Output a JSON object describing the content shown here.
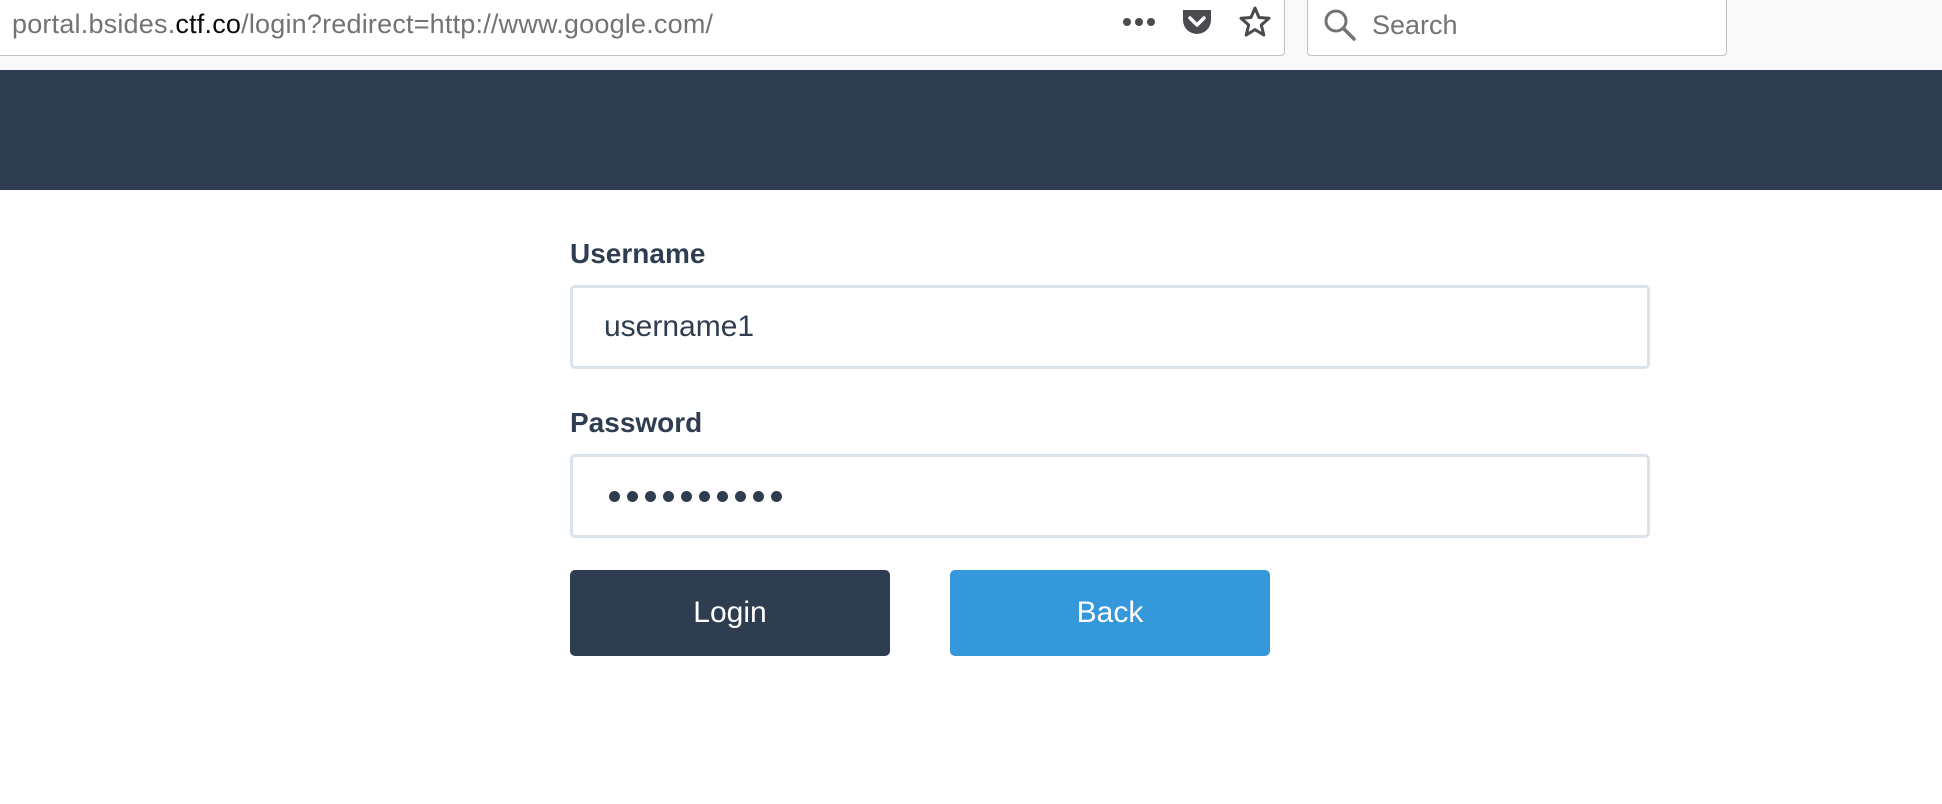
{
  "browser": {
    "url_prefix": "portal.bsides.",
    "url_host": "ctf.co",
    "url_path": "/login?redirect=http://www.google.com/",
    "actions": [
      {
        "icon": "more-icon"
      },
      {
        "icon": "pocket-icon"
      },
      {
        "icon": "star-icon"
      }
    ],
    "search_placeholder": "Search"
  },
  "form": {
    "username_label": "Username",
    "username_value": "username1",
    "password_label": "Password",
    "password_mask_length": 10,
    "login_label": "Login",
    "back_label": "Back"
  },
  "colors": {
    "header": "#2e3e50",
    "primary_button": "#2e3e50",
    "secondary_button": "#3498db",
    "input_border": "#dbe2ea"
  }
}
